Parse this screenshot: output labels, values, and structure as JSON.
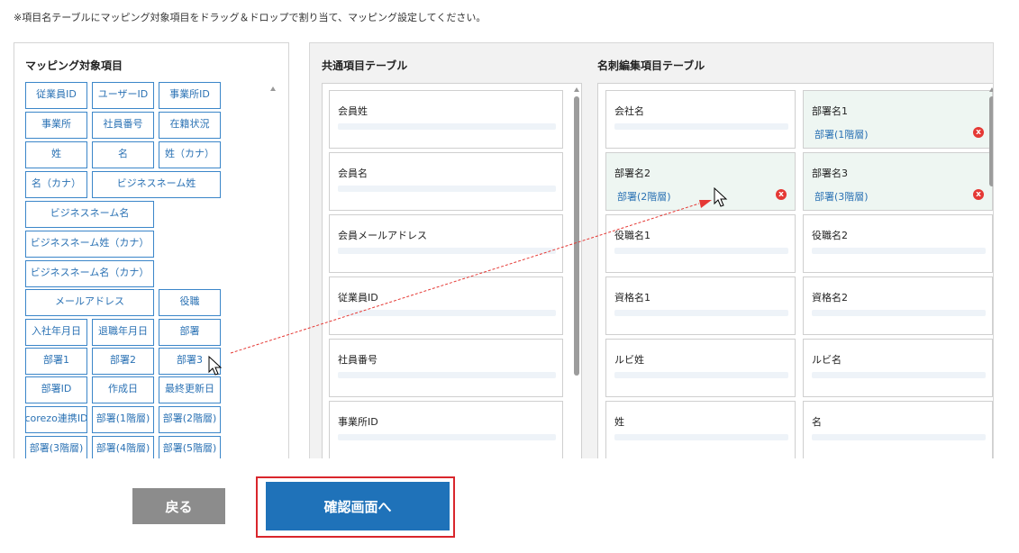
{
  "instruction": "※項目名テーブルにマッピング対象項目をドラッグ＆ドロップで割り当て、マッピング設定してください。",
  "left_panel": {
    "title": "マッピング対象項目",
    "chips": [
      "従業員ID",
      "ユーザーID",
      "事業所ID",
      "事業所",
      "社員番号",
      "在籍状況",
      "姓",
      "名",
      "姓（カナ）",
      "名（カナ）",
      "ビジネスネーム姓",
      "ビジネスネーム名",
      "ビジネスネーム姓（カナ）",
      "ビジネスネーム名（カナ）",
      "メールアドレス",
      "役職",
      "入社年月日",
      "退職年月日",
      "部署",
      "部署1",
      "部署2",
      "部署3",
      "部署ID",
      "作成日",
      "最終更新日",
      "corezo連携ID",
      "部署(1階層)",
      "部署(2階層)",
      "部署(3階層)",
      "部署(4階層)",
      "部署(5階層)"
    ]
  },
  "common_table": {
    "title": "共通項目テーブル",
    "fields": [
      "会員姓",
      "会員名",
      "会員メールアドレス",
      "従業員ID",
      "社員番号",
      "事業所ID"
    ]
  },
  "card_table": {
    "title": "名刺編集項目テーブル",
    "fields": [
      {
        "label": "会社名",
        "mapped": ""
      },
      {
        "label": "部署名1",
        "mapped": "部署(1階層)"
      },
      {
        "label": "部署名2",
        "mapped": "部署(2階層)"
      },
      {
        "label": "部署名3",
        "mapped": "部署(3階層)"
      },
      {
        "label": "役職名1",
        "mapped": ""
      },
      {
        "label": "役職名2",
        "mapped": ""
      },
      {
        "label": "資格名1",
        "mapped": ""
      },
      {
        "label": "資格名2",
        "mapped": ""
      },
      {
        "label": "ルビ姓",
        "mapped": ""
      },
      {
        "label": "ルビ名",
        "mapped": ""
      },
      {
        "label": "姓",
        "mapped": ""
      },
      {
        "label": "名",
        "mapped": ""
      }
    ],
    "remove_glyph": "x"
  },
  "buttons": {
    "back": "戻る",
    "confirm": "確認画面へ"
  },
  "colors": {
    "accent": "#1f72b9",
    "chip_border": "#3b86c9",
    "highlight_frame": "#d9262c",
    "drag_line": "#e53935",
    "remove": "#e53935"
  }
}
